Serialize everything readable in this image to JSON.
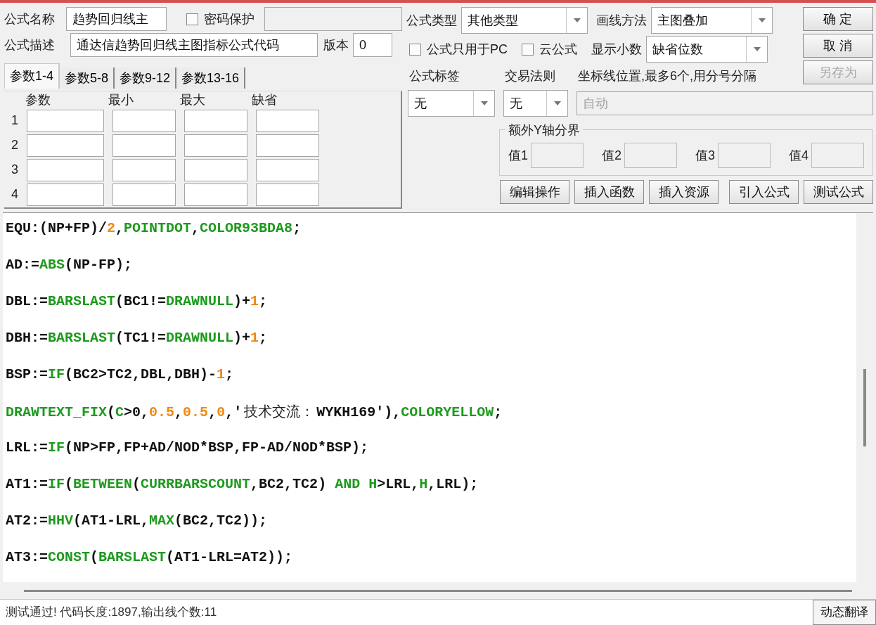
{
  "formula_name": {
    "label": "公式名称",
    "value": "趋势回归线主"
  },
  "password": {
    "label": "密码保护",
    "checked": false
  },
  "description": {
    "label": "公式描述",
    "value": "通达信趋势回归线主图指标公式代码"
  },
  "version": {
    "label": "版本",
    "value": "0"
  },
  "param_tabs": [
    {
      "label": "参数1-4",
      "selected": true
    },
    {
      "label": "参数5-8",
      "selected": false
    },
    {
      "label": "参数9-12",
      "selected": false
    },
    {
      "label": "参数13-16",
      "selected": false
    }
  ],
  "param_table": {
    "columns": [
      "参数",
      "最小",
      "最大",
      "缺省"
    ],
    "rows": [
      "1",
      "2",
      "3",
      "4"
    ]
  },
  "formula_type": {
    "label": "公式类型",
    "value": "其他类型"
  },
  "draw_method": {
    "label": "画线方法",
    "value": "主图叠加"
  },
  "pc_only": {
    "label": "公式只用于PC",
    "checked": false
  },
  "cloud": {
    "label": "云公式",
    "checked": false
  },
  "decimals": {
    "label": "显示小数",
    "value": "缺省位数"
  },
  "buttons": [
    {
      "label": "确 定",
      "disabled": false
    },
    {
      "label": "取 消",
      "disabled": false
    },
    {
      "label": "另存为",
      "disabled": true
    }
  ],
  "formula_tag": {
    "label": "公式标签",
    "value": "无"
  },
  "trade_rule": {
    "label": "交易法则",
    "value": "无"
  },
  "axis_lines": {
    "label": "坐标线位置,最多6个,用分号分隔",
    "placeholder": "自动",
    "disabled": true
  },
  "y_bounds": {
    "title": "额外Y轴分界",
    "fields": [
      "值1",
      "值2",
      "值3",
      "值4"
    ]
  },
  "action_buttons": [
    "编辑操作",
    "插入函数",
    "插入资源",
    "引入公式",
    "测试公式"
  ],
  "code_lines": [
    [
      {
        "text": "EQU:(NP+FP)/",
        "kind": "plain"
      },
      {
        "text": "2",
        "kind": "num"
      },
      {
        "text": ",",
        "kind": "plain"
      },
      {
        "text": "POINTDOT",
        "kind": "func"
      },
      {
        "text": ",",
        "kind": "plain"
      },
      {
        "text": "COLOR93BDA8",
        "kind": "func"
      },
      {
        "text": ";",
        "kind": "plain"
      }
    ],
    [
      {
        "text": "AD:=",
        "kind": "plain"
      },
      {
        "text": "ABS",
        "kind": "func"
      },
      {
        "text": "(NP-FP);",
        "kind": "plain"
      }
    ],
    [
      {
        "text": "DBL:=",
        "kind": "plain"
      },
      {
        "text": "BARSLAST",
        "kind": "func"
      },
      {
        "text": "(BC1!=",
        "kind": "plain"
      },
      {
        "text": "DRAWNULL",
        "kind": "func"
      },
      {
        "text": ")+",
        "kind": "plain"
      },
      {
        "text": "1",
        "kind": "num"
      },
      {
        "text": ";",
        "kind": "plain"
      }
    ],
    [
      {
        "text": "DBH:=",
        "kind": "plain"
      },
      {
        "text": "BARSLAST",
        "kind": "func"
      },
      {
        "text": "(TC1!=",
        "kind": "plain"
      },
      {
        "text": "DRAWNULL",
        "kind": "func"
      },
      {
        "text": ")+",
        "kind": "plain"
      },
      {
        "text": "1",
        "kind": "num"
      },
      {
        "text": ";",
        "kind": "plain"
      }
    ],
    [
      {
        "text": "BSP:=",
        "kind": "plain"
      },
      {
        "text": "IF",
        "kind": "func"
      },
      {
        "text": "(BC2>TC2,DBL,DBH)-",
        "kind": "plain"
      },
      {
        "text": "1",
        "kind": "num"
      },
      {
        "text": ";",
        "kind": "plain"
      }
    ],
    [
      {
        "text": "DRAWTEXT_FIX",
        "kind": "func"
      },
      {
        "text": "(",
        "kind": "plain"
      },
      {
        "text": "C",
        "kind": "func"
      },
      {
        "text": ">0,",
        "kind": "plain"
      },
      {
        "text": "0.5",
        "kind": "num"
      },
      {
        "text": ",",
        "kind": "plain"
      },
      {
        "text": "0.5",
        "kind": "num"
      },
      {
        "text": ",",
        "kind": "plain"
      },
      {
        "text": "0",
        "kind": "num"
      },
      {
        "text": ",'",
        "kind": "plain"
      },
      {
        "text": "技术交流：",
        "kind": "cn"
      },
      {
        "text": "WYKH169'),",
        "kind": "plain"
      },
      {
        "text": "COLORYELLOW",
        "kind": "func"
      },
      {
        "text": ";",
        "kind": "plain"
      }
    ],
    [
      {
        "text": "LRL:=",
        "kind": "plain"
      },
      {
        "text": "IF",
        "kind": "func"
      },
      {
        "text": "(NP>FP,FP+AD/NOD*BSP,FP-AD/NOD*BSP);",
        "kind": "plain"
      }
    ],
    [
      {
        "text": "AT1:=",
        "kind": "plain"
      },
      {
        "text": "IF",
        "kind": "func"
      },
      {
        "text": "(",
        "kind": "plain"
      },
      {
        "text": "BETWEEN",
        "kind": "func"
      },
      {
        "text": "(",
        "kind": "plain"
      },
      {
        "text": "CURRBARSCOUNT",
        "kind": "func"
      },
      {
        "text": ",BC2,TC2) ",
        "kind": "plain"
      },
      {
        "text": "AND H",
        "kind": "func"
      },
      {
        "text": ">LRL,",
        "kind": "plain"
      },
      {
        "text": "H",
        "kind": "func"
      },
      {
        "text": ",LRL);",
        "kind": "plain"
      }
    ],
    [
      {
        "text": "AT2:=",
        "kind": "plain"
      },
      {
        "text": "HHV",
        "kind": "func"
      },
      {
        "text": "(AT1-LRL,",
        "kind": "plain"
      },
      {
        "text": "MAX",
        "kind": "func"
      },
      {
        "text": "(BC2,TC2));",
        "kind": "plain"
      }
    ],
    [
      {
        "text": "AT3:=",
        "kind": "plain"
      },
      {
        "text": "CONST",
        "kind": "func"
      },
      {
        "text": "(",
        "kind": "plain"
      },
      {
        "text": "BARSLAST",
        "kind": "func"
      },
      {
        "text": "(AT1-LRL=AT2));",
        "kind": "plain"
      }
    ]
  ],
  "status": "测试通过! 代码长度:1897,输出线个数:11",
  "translate_button": "动态翻译"
}
